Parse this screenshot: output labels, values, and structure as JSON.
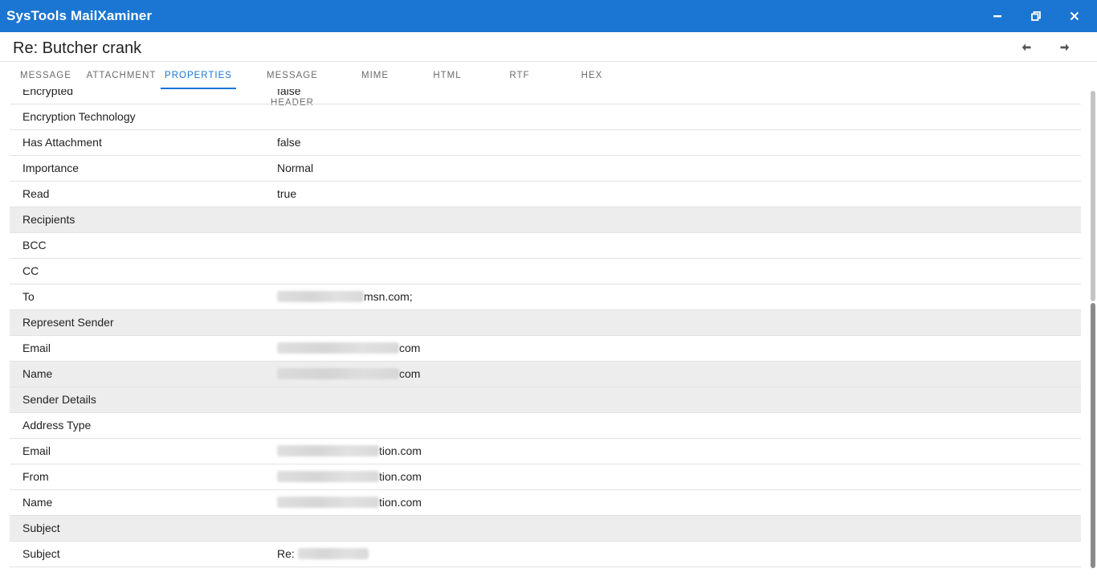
{
  "app": {
    "title": "SysTools MailXaminer"
  },
  "header": {
    "message_title": "Re: Butcher crank"
  },
  "tabs": [
    {
      "label": "MESSAGE"
    },
    {
      "label": "ATTACHMENT"
    },
    {
      "label": "PROPERTIES"
    },
    {
      "label": "MESSAGE HEADER"
    },
    {
      "label": "MIME"
    },
    {
      "label": "HTML"
    },
    {
      "label": "RTF"
    },
    {
      "label": "HEX"
    }
  ],
  "active_tab": "PROPERTIES",
  "properties": [
    {
      "key": "Encrypted",
      "value": "false",
      "section": false
    },
    {
      "key": "Encryption Technology",
      "value": "",
      "section": false
    },
    {
      "key": "Has Attachment",
      "value": "false",
      "section": false
    },
    {
      "key": "Importance",
      "value": "Normal",
      "section": false
    },
    {
      "key": "Read",
      "value": "true",
      "section": false
    },
    {
      "key": "Recipients",
      "value": "",
      "section": true
    },
    {
      "key": "BCC",
      "value": "",
      "section": false
    },
    {
      "key": "CC",
      "value": "",
      "section": false
    },
    {
      "key": "To",
      "value": "msn.com;",
      "section": false
    },
    {
      "key": "Represent Sender",
      "value": "",
      "section": true
    },
    {
      "key": "Email",
      "value": "com",
      "section": false
    },
    {
      "key": "Name",
      "value": "com",
      "section": true
    },
    {
      "key": "Sender Details",
      "value": "",
      "section": true
    },
    {
      "key": "Address Type",
      "value": "",
      "section": false
    },
    {
      "key": "Email",
      "value": "tion.com",
      "section": false
    },
    {
      "key": "From",
      "value": "tion.com",
      "section": false
    },
    {
      "key": "Name",
      "value": "tion.com",
      "section": false
    },
    {
      "key": "Subject",
      "value": "",
      "section": true
    },
    {
      "key": "Subject",
      "value": "Re:",
      "section": false
    }
  ],
  "colors": {
    "accent": "#1a76d2",
    "section_bg": "#ededed"
  },
  "icons": {
    "minimize": "minimize-icon",
    "restore": "restore-icon",
    "close": "close-icon",
    "prev": "arrow-left-icon",
    "next": "arrow-right-icon"
  }
}
